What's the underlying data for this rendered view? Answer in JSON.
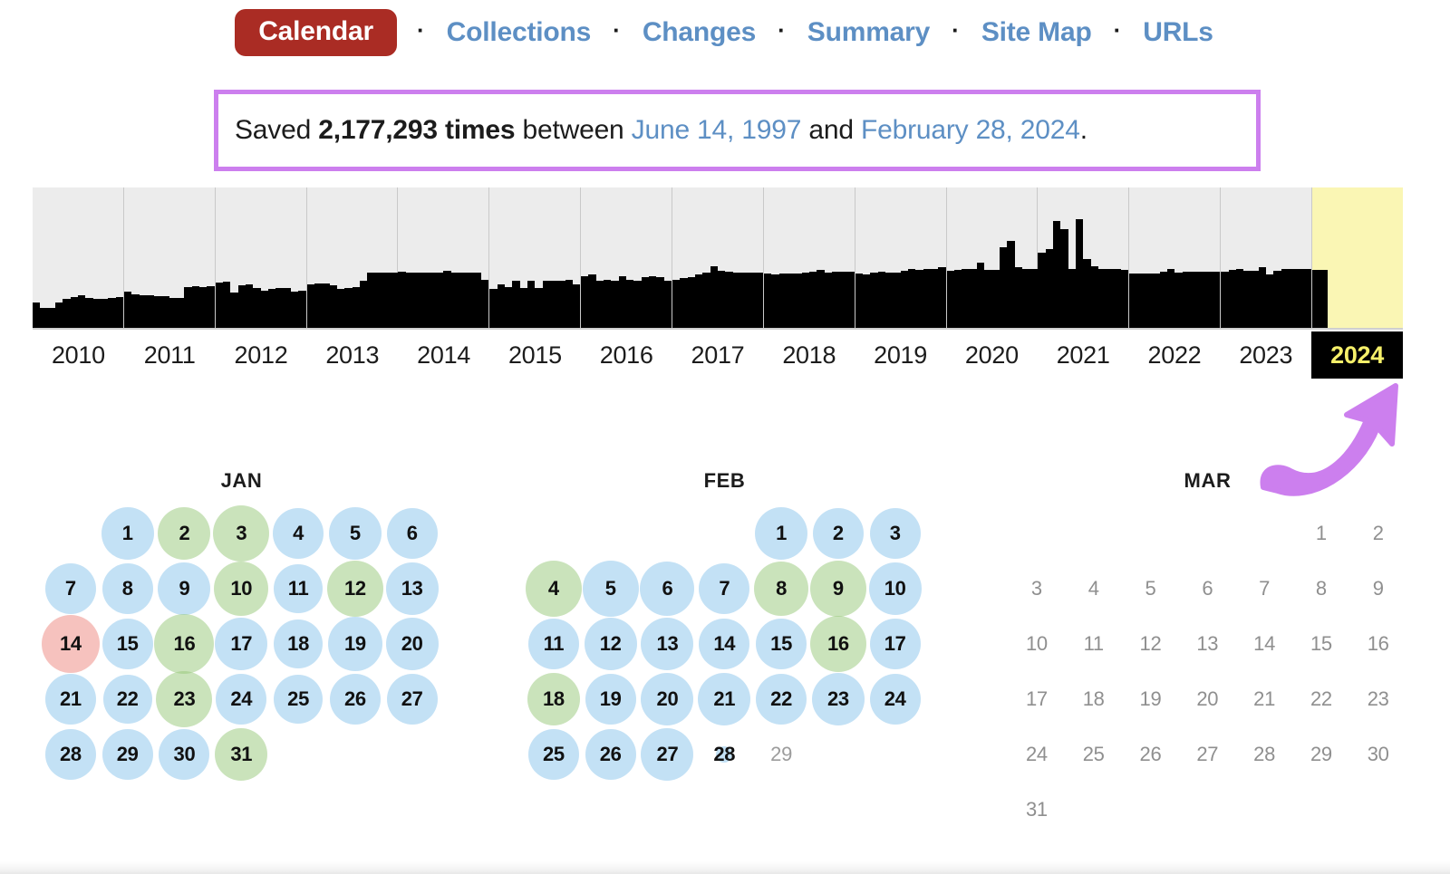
{
  "nav": {
    "active": "Calendar",
    "separator": "·",
    "items": [
      {
        "label": "Calendar",
        "active": true
      },
      {
        "label": "Collections",
        "active": false
      },
      {
        "label": "Changes",
        "active": false
      },
      {
        "label": "Summary",
        "active": false
      },
      {
        "label": "Site Map",
        "active": false
      },
      {
        "label": "URLs",
        "active": false
      }
    ]
  },
  "banner": {
    "prefix": "Saved ",
    "count": "2,177,293 times",
    "middle": " between ",
    "start_date": "June 14, 1997",
    "conjunction": " and ",
    "end_date": "February 28, 2024",
    "suffix": ".",
    "border_color": "#cc7fee"
  },
  "chart_data": {
    "type": "bar",
    "title": "Captures per month by year",
    "xlabel": "",
    "ylabel": "",
    "grid": false,
    "legend": false,
    "selected_year": "2024",
    "selected_color": "#f6f06a",
    "future_bg": "#faf6b4",
    "bar_color": "#000000",
    "plot_bg": "#ececec",
    "categories": [
      "2010",
      "2011",
      "2012",
      "2013",
      "2014",
      "2015",
      "2016",
      "2017",
      "2018",
      "2019",
      "2020",
      "2021",
      "2022",
      "2023",
      "2024"
    ],
    "series": [
      {
        "name": "2010",
        "values": [
          26,
          20,
          20,
          26,
          29,
          31,
          33,
          30,
          29,
          29,
          30,
          31
        ]
      },
      {
        "name": "2011",
        "values": [
          37,
          34,
          33,
          33,
          32,
          32,
          30,
          30,
          41,
          42,
          41,
          42
        ]
      },
      {
        "name": "2012",
        "values": [
          46,
          47,
          36,
          43,
          44,
          40,
          38,
          39,
          40,
          40,
          37,
          38
        ]
      },
      {
        "name": "2013",
        "values": [
          44,
          45,
          45,
          43,
          39,
          40,
          41,
          48,
          56,
          56,
          56,
          56
        ]
      },
      {
        "name": "2014",
        "values": [
          57,
          56,
          56,
          56,
          56,
          56,
          58,
          56,
          56,
          56,
          56,
          49
        ]
      },
      {
        "name": "2015",
        "values": [
          39,
          44,
          41,
          48,
          40,
          48,
          40,
          48,
          48,
          48,
          49,
          44
        ]
      },
      {
        "name": "2016",
        "values": [
          52,
          54,
          48,
          49,
          48,
          52,
          49,
          48,
          51,
          52,
          51,
          48
        ]
      },
      {
        "name": "2017",
        "values": [
          49,
          50,
          51,
          54,
          56,
          62,
          58,
          57,
          56,
          56,
          56,
          56
        ]
      },
      {
        "name": "2018",
        "values": [
          55,
          54,
          55,
          55,
          55,
          56,
          57,
          59,
          56,
          57,
          57,
          57
        ]
      },
      {
        "name": "2019",
        "values": [
          55,
          54,
          56,
          57,
          56,
          56,
          58,
          60,
          59,
          60,
          60,
          61
        ]
      },
      {
        "name": "2020",
        "values": [
          58,
          59,
          60,
          60,
          66,
          59,
          59,
          82,
          88,
          61,
          60,
          60
        ]
      },
      {
        "name": "2021",
        "values": [
          76,
          80,
          108,
          100,
          60,
          110,
          70,
          62,
          60,
          60,
          60,
          59
        ]
      },
      {
        "name": "2022",
        "values": [
          55,
          55,
          55,
          55,
          57,
          60,
          56,
          57,
          57,
          57,
          57,
          57
        ]
      },
      {
        "name": "2023",
        "values": [
          57,
          59,
          60,
          58,
          58,
          61,
          54,
          58,
          60,
          60,
          60,
          60
        ]
      },
      {
        "name": "2024",
        "values": [
          59,
          59
        ]
      }
    ]
  },
  "arrow": {
    "color": "#cc7fee",
    "points_to": "2024"
  },
  "calendars": [
    {
      "month": "JAN",
      "weeks": [
        [
          {
            "day": "",
            "blank": true
          },
          {
            "day": "1",
            "size": 58,
            "color": "blue"
          },
          {
            "day": "2",
            "size": 58,
            "color": "green"
          },
          {
            "day": "3",
            "size": 62,
            "color": "green"
          },
          {
            "day": "4",
            "size": 56,
            "color": "blue"
          },
          {
            "day": "5",
            "size": 58,
            "color": "blue"
          },
          {
            "day": "6",
            "size": 56,
            "color": "blue"
          }
        ],
        [
          {
            "day": "7",
            "size": 56,
            "color": "blue"
          },
          {
            "day": "8",
            "size": 56,
            "color": "blue"
          },
          {
            "day": "9",
            "size": 58,
            "color": "blue"
          },
          {
            "day": "10",
            "size": 60,
            "color": "green"
          },
          {
            "day": "11",
            "size": 54,
            "color": "blue"
          },
          {
            "day": "12",
            "size": 62,
            "color": "green"
          },
          {
            "day": "13",
            "size": 58,
            "color": "blue"
          }
        ],
        [
          {
            "day": "14",
            "size": 64,
            "color": "red"
          },
          {
            "day": "15",
            "size": 56,
            "color": "blue"
          },
          {
            "day": "16",
            "size": 66,
            "color": "green"
          },
          {
            "day": "17",
            "size": 58,
            "color": "blue"
          },
          {
            "day": "18",
            "size": 54,
            "color": "blue"
          },
          {
            "day": "19",
            "size": 60,
            "color": "blue"
          },
          {
            "day": "20",
            "size": 58,
            "color": "blue"
          }
        ],
        [
          {
            "day": "21",
            "size": 56,
            "color": "blue"
          },
          {
            "day": "22",
            "size": 54,
            "color": "blue"
          },
          {
            "day": "23",
            "size": 62,
            "color": "green"
          },
          {
            "day": "24",
            "size": 56,
            "color": "blue"
          },
          {
            "day": "25",
            "size": 54,
            "color": "blue"
          },
          {
            "day": "26",
            "size": 56,
            "color": "blue"
          },
          {
            "day": "27",
            "size": 56,
            "color": "blue"
          }
        ],
        [
          {
            "day": "28",
            "size": 56,
            "color": "blue"
          },
          {
            "day": "29",
            "size": 56,
            "color": "blue"
          },
          {
            "day": "30",
            "size": 56,
            "color": "blue"
          },
          {
            "day": "31",
            "size": 58,
            "color": "green"
          },
          {
            "day": "",
            "blank": true
          },
          {
            "day": "",
            "blank": true
          },
          {
            "day": "",
            "blank": true
          }
        ]
      ]
    },
    {
      "month": "FEB",
      "weeks": [
        [
          {
            "day": "",
            "blank": true
          },
          {
            "day": "",
            "blank": true
          },
          {
            "day": "",
            "blank": true
          },
          {
            "day": "",
            "blank": true
          },
          {
            "day": "1",
            "size": 58,
            "color": "blue"
          },
          {
            "day": "2",
            "size": 56,
            "color": "blue"
          },
          {
            "day": "3",
            "size": 56,
            "color": "blue"
          }
        ],
        [
          {
            "day": "4",
            "size": 62,
            "color": "green"
          },
          {
            "day": "5",
            "size": 62,
            "color": "blue"
          },
          {
            "day": "6",
            "size": 60,
            "color": "blue"
          },
          {
            "day": "7",
            "size": 56,
            "color": "blue"
          },
          {
            "day": "8",
            "size": 60,
            "color": "green"
          },
          {
            "day": "9",
            "size": 62,
            "color": "green"
          },
          {
            "day": "10",
            "size": 58,
            "color": "blue"
          }
        ],
        [
          {
            "day": "11",
            "size": 56,
            "color": "blue"
          },
          {
            "day": "12",
            "size": 58,
            "color": "blue"
          },
          {
            "day": "13",
            "size": 58,
            "color": "blue"
          },
          {
            "day": "14",
            "size": 56,
            "color": "blue"
          },
          {
            "day": "15",
            "size": 56,
            "color": "blue"
          },
          {
            "day": "16",
            "size": 62,
            "color": "green"
          },
          {
            "day": "17",
            "size": 56,
            "color": "blue"
          }
        ],
        [
          {
            "day": "18",
            "size": 58,
            "color": "green"
          },
          {
            "day": "19",
            "size": 56,
            "color": "blue"
          },
          {
            "day": "20",
            "size": 58,
            "color": "blue"
          },
          {
            "day": "21",
            "size": 58,
            "color": "blue"
          },
          {
            "day": "22",
            "size": 56,
            "color": "blue"
          },
          {
            "day": "23",
            "size": 58,
            "color": "blue"
          },
          {
            "day": "24",
            "size": 56,
            "color": "blue"
          }
        ],
        [
          {
            "day": "25",
            "size": 56,
            "color": "blue"
          },
          {
            "day": "26",
            "size": 56,
            "color": "blue"
          },
          {
            "day": "27",
            "size": 58,
            "color": "blue"
          },
          {
            "day": "28",
            "size": 18,
            "color": "blue"
          },
          {
            "day": "29",
            "size": 0,
            "color": "none",
            "empty": true
          },
          {
            "day": "",
            "blank": true
          },
          {
            "day": "",
            "blank": true
          }
        ]
      ]
    },
    {
      "month": "MAR",
      "weeks": [
        [
          {
            "day": "",
            "blank": true
          },
          {
            "day": "",
            "blank": true
          },
          {
            "day": "",
            "blank": true
          },
          {
            "day": "",
            "blank": true
          },
          {
            "day": "",
            "blank": true
          },
          {
            "day": "1",
            "size": 0,
            "future": true
          },
          {
            "day": "2",
            "size": 0,
            "future": true
          }
        ],
        [
          {
            "day": "3",
            "size": 0,
            "future": true
          },
          {
            "day": "4",
            "size": 0,
            "future": true
          },
          {
            "day": "5",
            "size": 0,
            "future": true
          },
          {
            "day": "6",
            "size": 0,
            "future": true
          },
          {
            "day": "7",
            "size": 0,
            "future": true
          },
          {
            "day": "8",
            "size": 0,
            "future": true
          },
          {
            "day": "9",
            "size": 0,
            "future": true
          }
        ],
        [
          {
            "day": "10",
            "size": 0,
            "future": true
          },
          {
            "day": "11",
            "size": 0,
            "future": true
          },
          {
            "day": "12",
            "size": 0,
            "future": true
          },
          {
            "day": "13",
            "size": 0,
            "future": true
          },
          {
            "day": "14",
            "size": 0,
            "future": true
          },
          {
            "day": "15",
            "size": 0,
            "future": true
          },
          {
            "day": "16",
            "size": 0,
            "future": true
          }
        ],
        [
          {
            "day": "17",
            "size": 0,
            "future": true
          },
          {
            "day": "18",
            "size": 0,
            "future": true
          },
          {
            "day": "19",
            "size": 0,
            "future": true
          },
          {
            "day": "20",
            "size": 0,
            "future": true
          },
          {
            "day": "21",
            "size": 0,
            "future": true
          },
          {
            "day": "22",
            "size": 0,
            "future": true
          },
          {
            "day": "23",
            "size": 0,
            "future": true
          }
        ],
        [
          {
            "day": "24",
            "size": 0,
            "future": true
          },
          {
            "day": "25",
            "size": 0,
            "future": true
          },
          {
            "day": "26",
            "size": 0,
            "future": true
          },
          {
            "day": "27",
            "size": 0,
            "future": true
          },
          {
            "day": "28",
            "size": 0,
            "future": true
          },
          {
            "day": "29",
            "size": 0,
            "future": true
          },
          {
            "day": "30",
            "size": 0,
            "future": true
          }
        ],
        [
          {
            "day": "31",
            "size": 0,
            "future": true
          },
          {
            "day": "",
            "blank": true
          },
          {
            "day": "",
            "blank": true
          },
          {
            "day": "",
            "blank": true
          },
          {
            "day": "",
            "blank": true
          },
          {
            "day": "",
            "blank": true
          },
          {
            "day": "",
            "blank": true
          }
        ]
      ]
    }
  ],
  "bubble_colors": {
    "blue": "rgba(135,195,235,0.50)",
    "green": "rgba(150,200,120,0.50)",
    "red": "rgba(235,120,110,0.45)"
  }
}
